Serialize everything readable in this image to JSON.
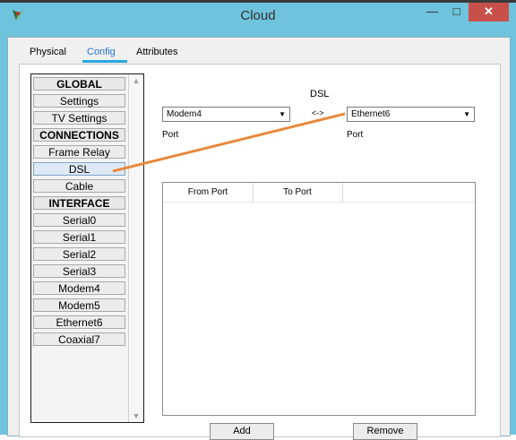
{
  "window": {
    "title": "Cloud",
    "controls": {
      "minimize": "—",
      "maximize": "□",
      "close": "✕"
    }
  },
  "tabs": [
    {
      "label": "Physical"
    },
    {
      "label": "Config",
      "active": true
    },
    {
      "label": "Attributes"
    }
  ],
  "sidebar": {
    "items": [
      {
        "label": "GLOBAL",
        "header": true
      },
      {
        "label": "Settings"
      },
      {
        "label": "TV Settings"
      },
      {
        "label": "CONNECTIONS",
        "header": true
      },
      {
        "label": "Frame Relay"
      },
      {
        "label": "DSL",
        "selected": true
      },
      {
        "label": "Cable"
      },
      {
        "label": "INTERFACE",
        "header": true
      },
      {
        "label": "Serial0"
      },
      {
        "label": "Serial1"
      },
      {
        "label": "Serial2"
      },
      {
        "label": "Serial3"
      },
      {
        "label": "Modem4"
      },
      {
        "label": "Modem5"
      },
      {
        "label": "Ethernet6"
      },
      {
        "label": "Coaxial7"
      }
    ]
  },
  "dsl": {
    "heading": "DSL",
    "separator": "<->",
    "left_select": {
      "value": "Modem4",
      "label": "Port"
    },
    "right_select": {
      "value": "Ethernet6",
      "label": "Port"
    },
    "table": {
      "columns": [
        "From Port",
        "To Port"
      ],
      "rows": []
    },
    "add_button": "Add",
    "remove_button": "Remove"
  },
  "colors": {
    "window_frame": "#6fc3dc",
    "close_button": "#c7504b",
    "active_tab": "#2277cc",
    "annotation_line": "#e8873a"
  }
}
